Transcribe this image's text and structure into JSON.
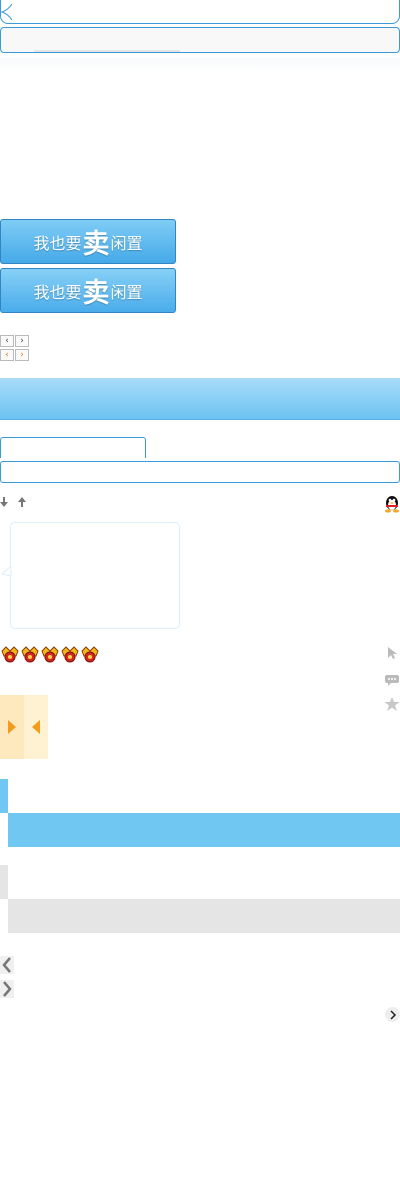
{
  "sell_button": {
    "prefix": "我也要",
    "emphasis": "卖",
    "suffix": "闲置"
  },
  "colors": {
    "accent_blue": "#3a9ad9",
    "button_blue": "#45a9e8",
    "band_blue": "#6fc7f2",
    "grey_tab": "#e5e5e5",
    "orange_arrow": "#f39b1c",
    "orange_bg": "#fde9bd"
  },
  "icons": {
    "mini_pager_1": [
      "chevron-left-icon",
      "chevron-right-icon"
    ],
    "mini_pager_2": [
      "chevron-left-orange-icon",
      "chevron-right-orange-icon"
    ],
    "sort_down": "arrow-down-icon",
    "sort_up": "arrow-up-icon",
    "qq": "qq-penguin-icon",
    "medals": [
      "crown-medal-icon",
      "crown-medal-icon",
      "crown-medal-icon",
      "crown-medal-icon",
      "crown-medal-icon"
    ],
    "side": [
      "cursor-icon",
      "comment-icon",
      "star-icon"
    ],
    "nav": [
      "chevron-left-icon",
      "chevron-right-icon"
    ],
    "next": "chevron-right-round-icon"
  }
}
